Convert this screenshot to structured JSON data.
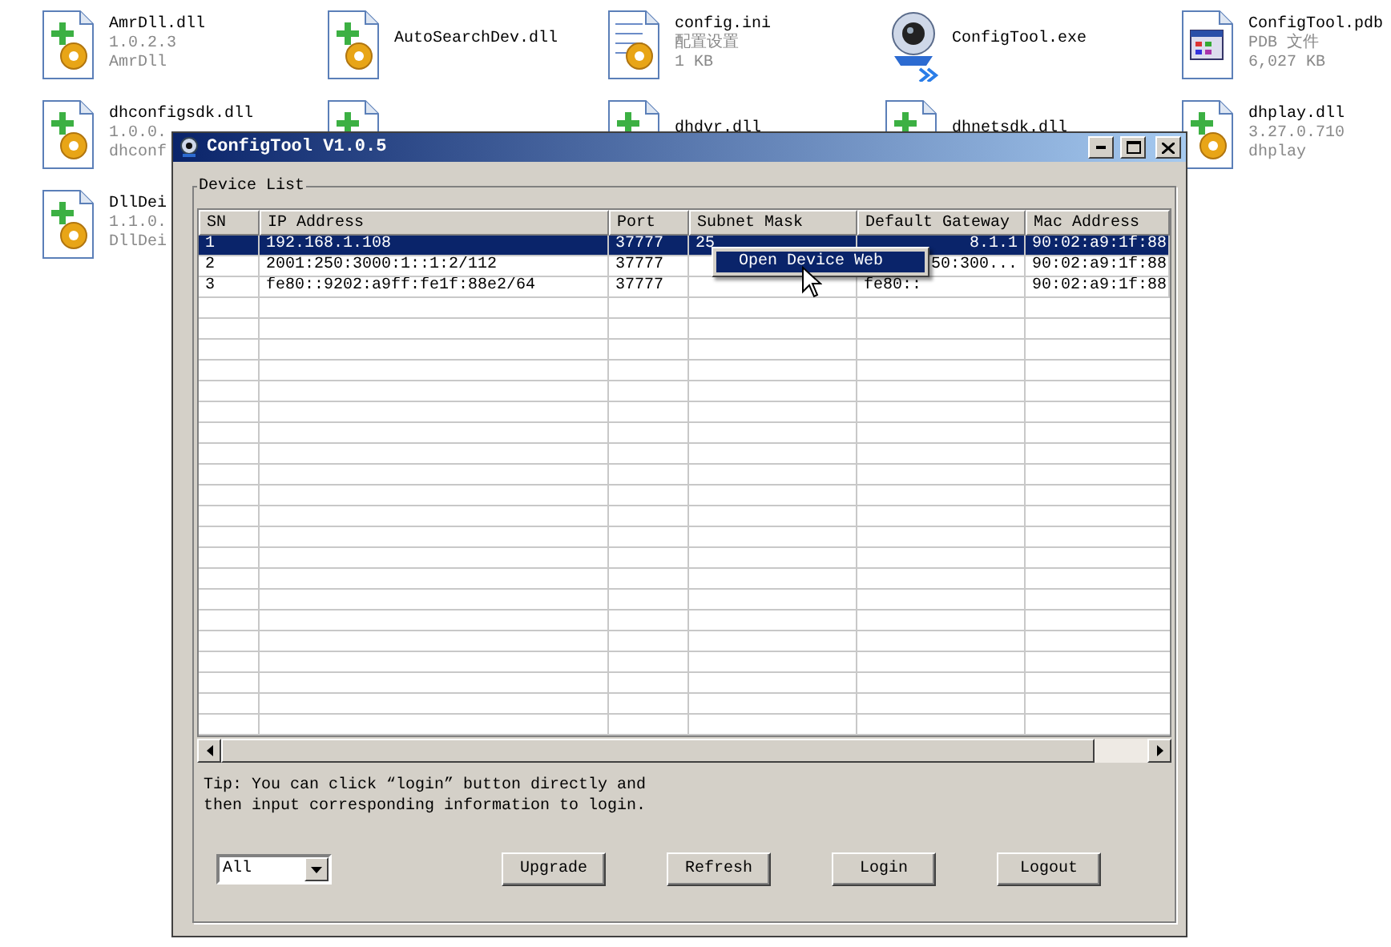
{
  "desktop_icons": [
    {
      "kind": "dll",
      "lines": [
        "AmrDll.dll",
        "1.0.2.3",
        "AmrDll"
      ]
    },
    {
      "kind": "dll",
      "lines": [
        "AutoSearchDev.dll"
      ]
    },
    {
      "kind": "ini",
      "lines": [
        "config.ini",
        "配置设置",
        "1 KB"
      ]
    },
    {
      "kind": "exe",
      "lines": [
        "ConfigTool.exe"
      ]
    },
    {
      "kind": "pdb",
      "lines": [
        "ConfigTool.pdb",
        "PDB 文件",
        "6,027 KB"
      ]
    },
    {
      "kind": "dll",
      "lines": [
        "dhconfigsdk.dll",
        "1.0.0.",
        "dhconf"
      ]
    },
    {
      "kind": "dll"
    },
    {
      "kind": "dll",
      "lines": [
        "dhdvr.dll"
      ]
    },
    {
      "kind": "dll",
      "lines": [
        "dhnetsdk.dll"
      ]
    },
    {
      "kind": "dll",
      "lines": [
        "dhplay.dll",
        "3.27.0.710",
        "dhplay"
      ]
    },
    {
      "kind": "dll",
      "lines": [
        "DllDei",
        "1.1.0.",
        "DllDei"
      ]
    }
  ],
  "window": {
    "title": "ConfigTool V1.0.5",
    "group_title": "Device List",
    "table": {
      "columns": [
        "SN",
        "IP Address",
        "Port",
        "Subnet Mask",
        "Default Gateway",
        "Mac Address"
      ],
      "rows": [
        {
          "selected": true,
          "cells": [
            {
              "text": "1"
            },
            {
              "text": "192.168.1.108"
            },
            {
              "text": "37777"
            },
            {
              "text": "25"
            },
            {
              "text": "8.1.1",
              "clipped": true
            },
            {
              "text": "90:02:a9:1f:88"
            }
          ]
        },
        {
          "selected": false,
          "cells": [
            {
              "text": "2"
            },
            {
              "text": "2001:250:3000:1::1:2/112"
            },
            {
              "text": "37777"
            },
            {},
            {
              "text": "50:300...",
              "clipped": true
            },
            {
              "text": "90:02:a9:1f:88"
            }
          ]
        },
        {
          "selected": false,
          "cells": [
            {
              "text": "3"
            },
            {
              "text": "fe80::9202:a9ff:fe1f:88e2/64"
            },
            {
              "text": "37777"
            },
            {},
            {
              "text": "fe80::"
            },
            {
              "text": "90:02:a9:1f:88"
            }
          ]
        }
      ]
    },
    "context_menu": {
      "items": [
        "Open Device Web"
      ]
    },
    "tip": "Tip: You can click “login” button directly and then input corresponding information to login.",
    "filter": {
      "value": "All"
    },
    "buttons": [
      "Upgrade",
      "Refresh",
      "Login",
      "Logout"
    ]
  }
}
